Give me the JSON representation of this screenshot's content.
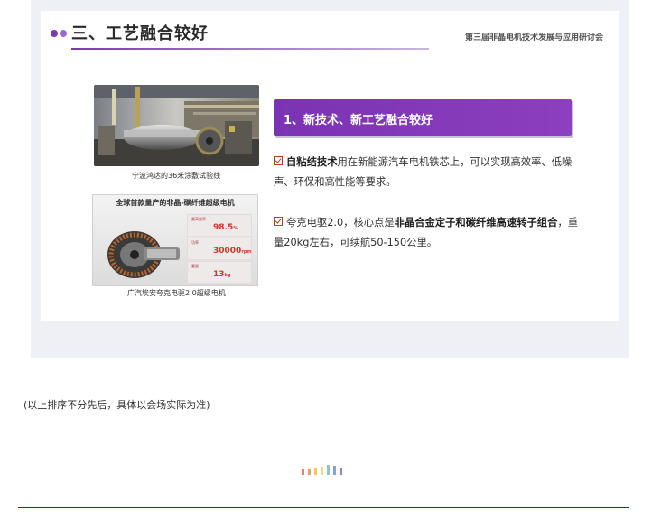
{
  "slide": {
    "title": "三、工艺融合较好",
    "subtitle": "第三届非晶电机技术发展与应用研讨会",
    "dot_colors": [
      "#7b3bb0",
      "#9a6ad0"
    ]
  },
  "images": {
    "photo1_caption": "宁波鸿达的36米涂敷试验线",
    "photo2_caption": "广汽埃安夸克电驱2.0超级电机",
    "photo2_ad": {
      "title": "全球首款量产的非晶-碳纤维超级电机",
      "stats": [
        {
          "label": "最高效率",
          "value": "98.5",
          "unit": "%"
        },
        {
          "label": "功率",
          "value": "30000",
          "unit": "rpm"
        },
        {
          "label": "重量",
          "value": "13",
          "unit": "kg"
        }
      ]
    }
  },
  "content": {
    "banner": "1、新技术、新工艺融合较好",
    "p1_bold": "自粘结技术",
    "p1_rest": "用在新能源汽车电机铁芯上，可以实现高效率、低噪声、环保和高性能等要求。",
    "p2_pre": "夸克电驱2.0，核心点是",
    "p2_bold": "非晶合金定子和碳纤维高速转子组合",
    "p2_rest": "，重量20kg左右，可续航50-150公里。"
  },
  "footer": {
    "note": "(以上排序不分先后，具体以会场实际为准)"
  },
  "colors": {
    "accent": "#7b3bb0",
    "check": "#c0392b",
    "divider": "#1f3b57"
  }
}
